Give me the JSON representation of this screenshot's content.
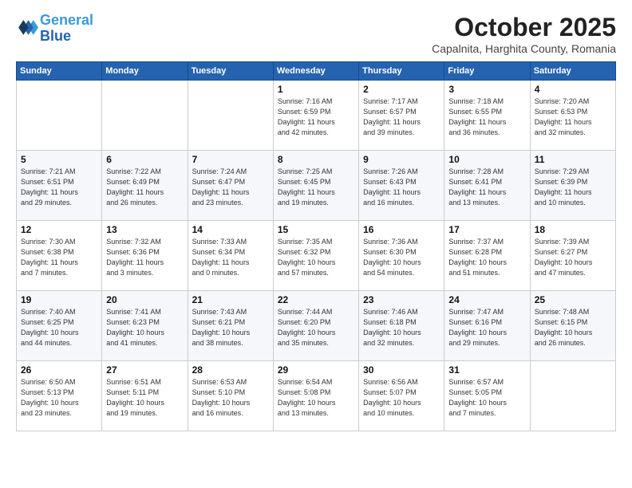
{
  "header": {
    "logo_line1": "General",
    "logo_line2": "Blue",
    "month": "October 2025",
    "location": "Capalnita, Harghita County, Romania"
  },
  "days_of_week": [
    "Sunday",
    "Monday",
    "Tuesday",
    "Wednesday",
    "Thursday",
    "Friday",
    "Saturday"
  ],
  "weeks": [
    [
      {
        "num": "",
        "info": ""
      },
      {
        "num": "",
        "info": ""
      },
      {
        "num": "",
        "info": ""
      },
      {
        "num": "1",
        "info": "Sunrise: 7:16 AM\nSunset: 6:59 PM\nDaylight: 11 hours\nand 42 minutes."
      },
      {
        "num": "2",
        "info": "Sunrise: 7:17 AM\nSunset: 6:57 PM\nDaylight: 11 hours\nand 39 minutes."
      },
      {
        "num": "3",
        "info": "Sunrise: 7:18 AM\nSunset: 6:55 PM\nDaylight: 11 hours\nand 36 minutes."
      },
      {
        "num": "4",
        "info": "Sunrise: 7:20 AM\nSunset: 6:53 PM\nDaylight: 11 hours\nand 32 minutes."
      }
    ],
    [
      {
        "num": "5",
        "info": "Sunrise: 7:21 AM\nSunset: 6:51 PM\nDaylight: 11 hours\nand 29 minutes."
      },
      {
        "num": "6",
        "info": "Sunrise: 7:22 AM\nSunset: 6:49 PM\nDaylight: 11 hours\nand 26 minutes."
      },
      {
        "num": "7",
        "info": "Sunrise: 7:24 AM\nSunset: 6:47 PM\nDaylight: 11 hours\nand 23 minutes."
      },
      {
        "num": "8",
        "info": "Sunrise: 7:25 AM\nSunset: 6:45 PM\nDaylight: 11 hours\nand 19 minutes."
      },
      {
        "num": "9",
        "info": "Sunrise: 7:26 AM\nSunset: 6:43 PM\nDaylight: 11 hours\nand 16 minutes."
      },
      {
        "num": "10",
        "info": "Sunrise: 7:28 AM\nSunset: 6:41 PM\nDaylight: 11 hours\nand 13 minutes."
      },
      {
        "num": "11",
        "info": "Sunrise: 7:29 AM\nSunset: 6:39 PM\nDaylight: 11 hours\nand 10 minutes."
      }
    ],
    [
      {
        "num": "12",
        "info": "Sunrise: 7:30 AM\nSunset: 6:38 PM\nDaylight: 11 hours\nand 7 minutes."
      },
      {
        "num": "13",
        "info": "Sunrise: 7:32 AM\nSunset: 6:36 PM\nDaylight: 11 hours\nand 3 minutes."
      },
      {
        "num": "14",
        "info": "Sunrise: 7:33 AM\nSunset: 6:34 PM\nDaylight: 11 hours\nand 0 minutes."
      },
      {
        "num": "15",
        "info": "Sunrise: 7:35 AM\nSunset: 6:32 PM\nDaylight: 10 hours\nand 57 minutes."
      },
      {
        "num": "16",
        "info": "Sunrise: 7:36 AM\nSunset: 6:30 PM\nDaylight: 10 hours\nand 54 minutes."
      },
      {
        "num": "17",
        "info": "Sunrise: 7:37 AM\nSunset: 6:28 PM\nDaylight: 10 hours\nand 51 minutes."
      },
      {
        "num": "18",
        "info": "Sunrise: 7:39 AM\nSunset: 6:27 PM\nDaylight: 10 hours\nand 47 minutes."
      }
    ],
    [
      {
        "num": "19",
        "info": "Sunrise: 7:40 AM\nSunset: 6:25 PM\nDaylight: 10 hours\nand 44 minutes."
      },
      {
        "num": "20",
        "info": "Sunrise: 7:41 AM\nSunset: 6:23 PM\nDaylight: 10 hours\nand 41 minutes."
      },
      {
        "num": "21",
        "info": "Sunrise: 7:43 AM\nSunset: 6:21 PM\nDaylight: 10 hours\nand 38 minutes."
      },
      {
        "num": "22",
        "info": "Sunrise: 7:44 AM\nSunset: 6:20 PM\nDaylight: 10 hours\nand 35 minutes."
      },
      {
        "num": "23",
        "info": "Sunrise: 7:46 AM\nSunset: 6:18 PM\nDaylight: 10 hours\nand 32 minutes."
      },
      {
        "num": "24",
        "info": "Sunrise: 7:47 AM\nSunset: 6:16 PM\nDaylight: 10 hours\nand 29 minutes."
      },
      {
        "num": "25",
        "info": "Sunrise: 7:48 AM\nSunset: 6:15 PM\nDaylight: 10 hours\nand 26 minutes."
      }
    ],
    [
      {
        "num": "26",
        "info": "Sunrise: 6:50 AM\nSunset: 5:13 PM\nDaylight: 10 hours\nand 23 minutes."
      },
      {
        "num": "27",
        "info": "Sunrise: 6:51 AM\nSunset: 5:11 PM\nDaylight: 10 hours\nand 19 minutes."
      },
      {
        "num": "28",
        "info": "Sunrise: 6:53 AM\nSunset: 5:10 PM\nDaylight: 10 hours\nand 16 minutes."
      },
      {
        "num": "29",
        "info": "Sunrise: 6:54 AM\nSunset: 5:08 PM\nDaylight: 10 hours\nand 13 minutes."
      },
      {
        "num": "30",
        "info": "Sunrise: 6:56 AM\nSunset: 5:07 PM\nDaylight: 10 hours\nand 10 minutes."
      },
      {
        "num": "31",
        "info": "Sunrise: 6:57 AM\nSunset: 5:05 PM\nDaylight: 10 hours\nand 7 minutes."
      },
      {
        "num": "",
        "info": ""
      }
    ]
  ]
}
